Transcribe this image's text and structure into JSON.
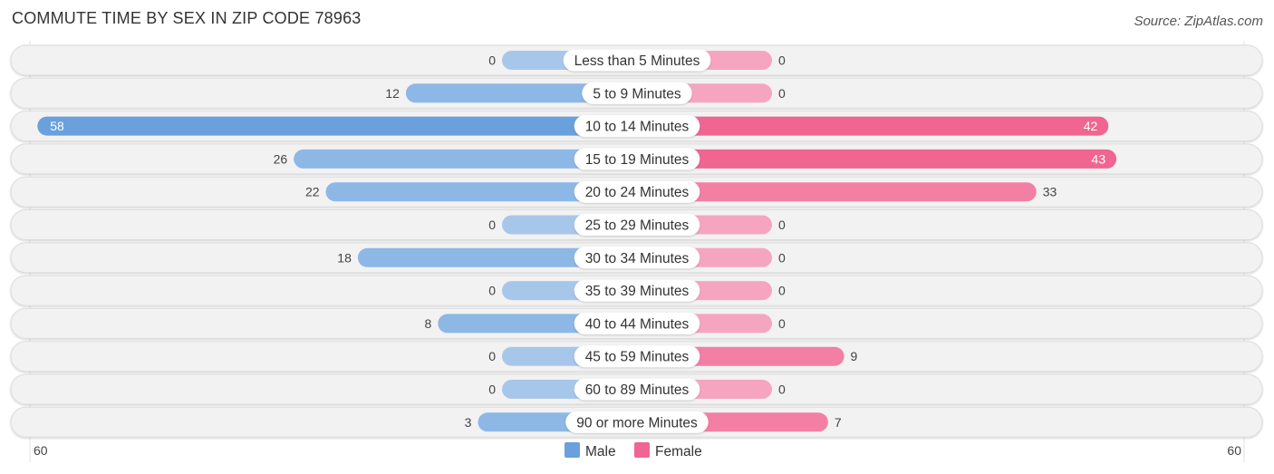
{
  "header": {
    "title": "COMMUTE TIME BY SEX IN ZIP CODE 78963",
    "source": "Source: ZipAtlas.com"
  },
  "colors": {
    "male": "#6aa0dc",
    "male_light": "#a7c7ea",
    "female": "#f06592",
    "female_light": "#f6a5c0",
    "row_bg": "#f2f2f2"
  },
  "chart_data": {
    "type": "bar",
    "orientation": "horizontal-butterfly",
    "title": "COMMUTE TIME BY SEX IN ZIP CODE 78963",
    "categories": [
      "Less than 5 Minutes",
      "5 to 9 Minutes",
      "10 to 14 Minutes",
      "15 to 19 Minutes",
      "20 to 24 Minutes",
      "25 to 29 Minutes",
      "30 to 34 Minutes",
      "35 to 39 Minutes",
      "40 to 44 Minutes",
      "45 to 59 Minutes",
      "60 to 89 Minutes",
      "90 or more Minutes"
    ],
    "series": [
      {
        "name": "Male",
        "values": [
          0,
          12,
          58,
          26,
          22,
          0,
          18,
          0,
          8,
          0,
          0,
          3
        ]
      },
      {
        "name": "Female",
        "values": [
          0,
          0,
          42,
          43,
          33,
          0,
          0,
          0,
          0,
          9,
          0,
          7
        ]
      }
    ],
    "axis": {
      "left_label": "60",
      "right_label": "60",
      "range": [
        0,
        60
      ]
    },
    "legend": {
      "position": "bottom-center",
      "entries": [
        "Male",
        "Female"
      ]
    }
  }
}
